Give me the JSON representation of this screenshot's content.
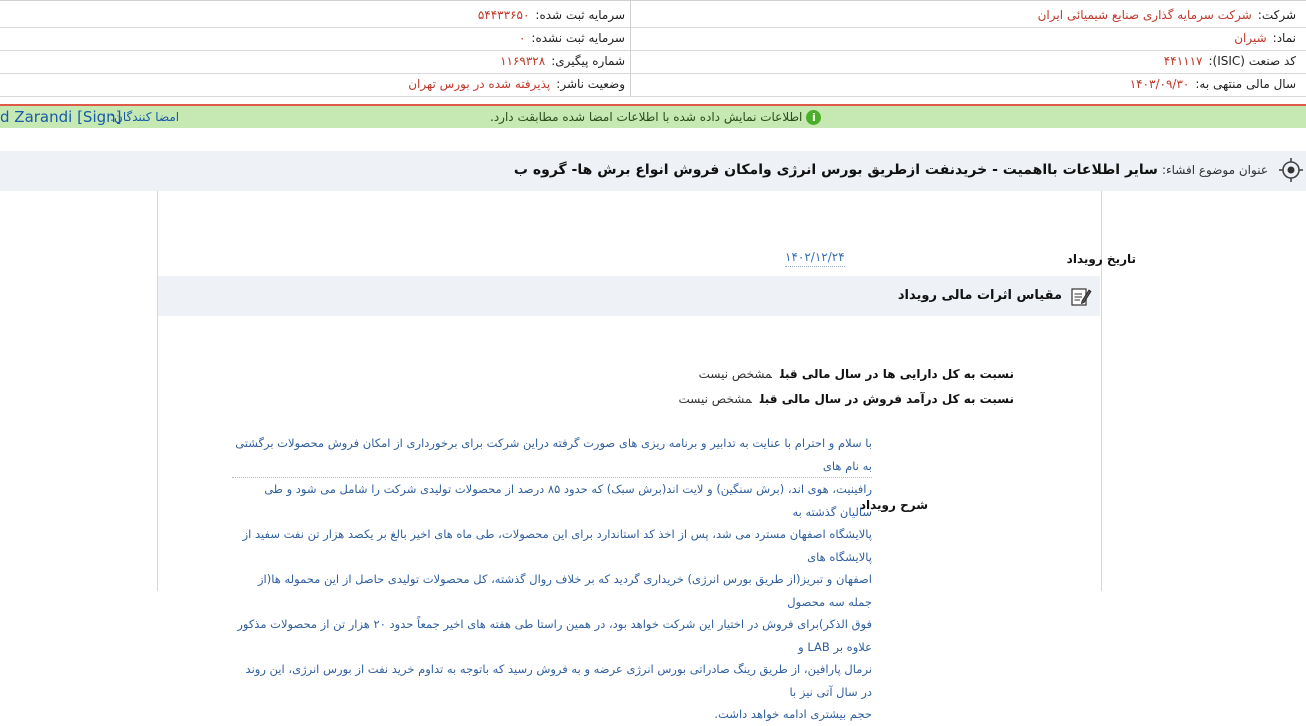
{
  "header": {
    "company_label": "شرکت:",
    "company_value": "شرکت سرمایه گذاری صنایع شیمیائی ایران",
    "registered_capital_label": "سرمایه ثبت شده:",
    "registered_capital_value": "۵۴۴۳۳۶۵۰",
    "symbol_label": "نماد:",
    "symbol_value": "شیران",
    "unregistered_capital_label": "سرمایه ثبت نشده:",
    "unregistered_capital_value": "۰",
    "isic_label": "کد صنعت (ISIC):",
    "isic_value": "۴۴۱۱۱۷",
    "tracking_label": "شماره پیگیری:",
    "tracking_value": "۱۱۶۹۳۲۸",
    "fiscal_year_label": "سال مالی منتهی به:",
    "fiscal_year_value": "۱۴۰۳/۰۹/۳۰",
    "publisher_status_label": "وضعیت ناشر:",
    "publisher_status_value": "پذیرفته شده در بورس تهران"
  },
  "banner": {
    "message": "اطلاعات نمایش داده شده با اطلاعات امضا شده مطابقت دارد.",
    "signers_label": "امضا کنندگان:",
    "signer_name": "d Zarandi [Sign]"
  },
  "subject": {
    "label": "عنوان موضوع افشاء:",
    "value": "سایر اطلاعات بااهمیت - خریدنفت ازطریق بورس انرژی وامکان فروش انواع برش ها- گروه ب"
  },
  "event": {
    "date_label": "تاریخ رویداد",
    "date_value": "۱۴۰۲/۱۲/۲۴"
  },
  "section": {
    "title": "مقیاس اثرات مالی رویداد"
  },
  "ratios": [
    {
      "label": "نسبت به کل دارایی ها در سال مالی قبل",
      "value": "مشخص نیست"
    },
    {
      "label": "نسبت به کل درآمد فروش در سال مالی قبل",
      "value": "مشخص نیست"
    }
  ],
  "description": {
    "label": "شرح رویداد",
    "line1": "با سلام و احترام با عنایت به تدابیر و برنامه ریزی های صورت گرفته دراین شرکت برای برخورداری از امکان فروش محصولات برگشتی به نام های",
    "line2": "رافینیت، هوی اند، (برش سنگین) و لایت اند(برش سبک) که حدود ۸۵ درصد از محصولات تولیدی شرکت را شامل می شود و طی سالیان گذشته به",
    "line3": "پالایشگاه اصفهان مسترد می شد، پس از اخذ کد استاندارد برای این محصولات، طی ماه های اخیر بالغ بر یکصد هزار تن نفت سفید از پالایشگاه های",
    "line4": "اصفهان و تبریز(از طریق بورس انرژی) خریداری گردید که بر خلاف روال گذشته، کل محصولات تولیدی حاصل از این محموله ها(از جمله سه محصول",
    "line5": "فوق الذکر)برای فروش در اختیار این شرکت خواهد بود، در همین راستا طی هفته های اخیر جمعاً حدود ۲۰ هزار تن از محصولات مذکور علاوه بر LAB و",
    "line6": "نرمال پارافین، از طریق رینگ صادراتی بورس انرژی عرضه و به فروش رسید که باتوجه به تداوم خرید نفت از بورس انرژی، این روند در سال آتی نیز با",
    "line7": "حجم بیشتری ادامه خواهد داشت."
  }
}
